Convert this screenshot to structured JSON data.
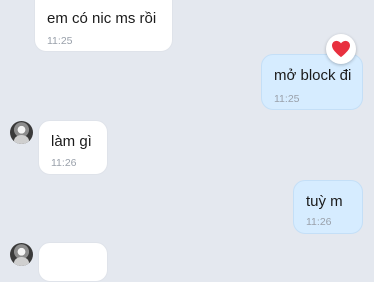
{
  "messages": [
    {
      "direction": "incoming",
      "text": "em có nic ms rồi",
      "time": "11:25"
    },
    {
      "direction": "outgoing",
      "text": "mở block đi",
      "time": "11:25",
      "reaction": "heart"
    },
    {
      "direction": "incoming",
      "text": "làm gì",
      "time": "11:26",
      "avatar": true
    },
    {
      "direction": "outgoing",
      "text": "tuỳ m",
      "time": "11:26"
    },
    {
      "direction": "incoming",
      "text": "",
      "time": "",
      "avatar": true
    }
  ],
  "colors": {
    "background": "#e4e8ef",
    "incoming_bubble": "#ffffff",
    "outgoing_bubble": "#d6ecff",
    "time_text": "#9aa1ab",
    "heart": "#e8303f"
  },
  "icons": {
    "reaction": "heart-icon",
    "avatar": "user-avatar"
  }
}
